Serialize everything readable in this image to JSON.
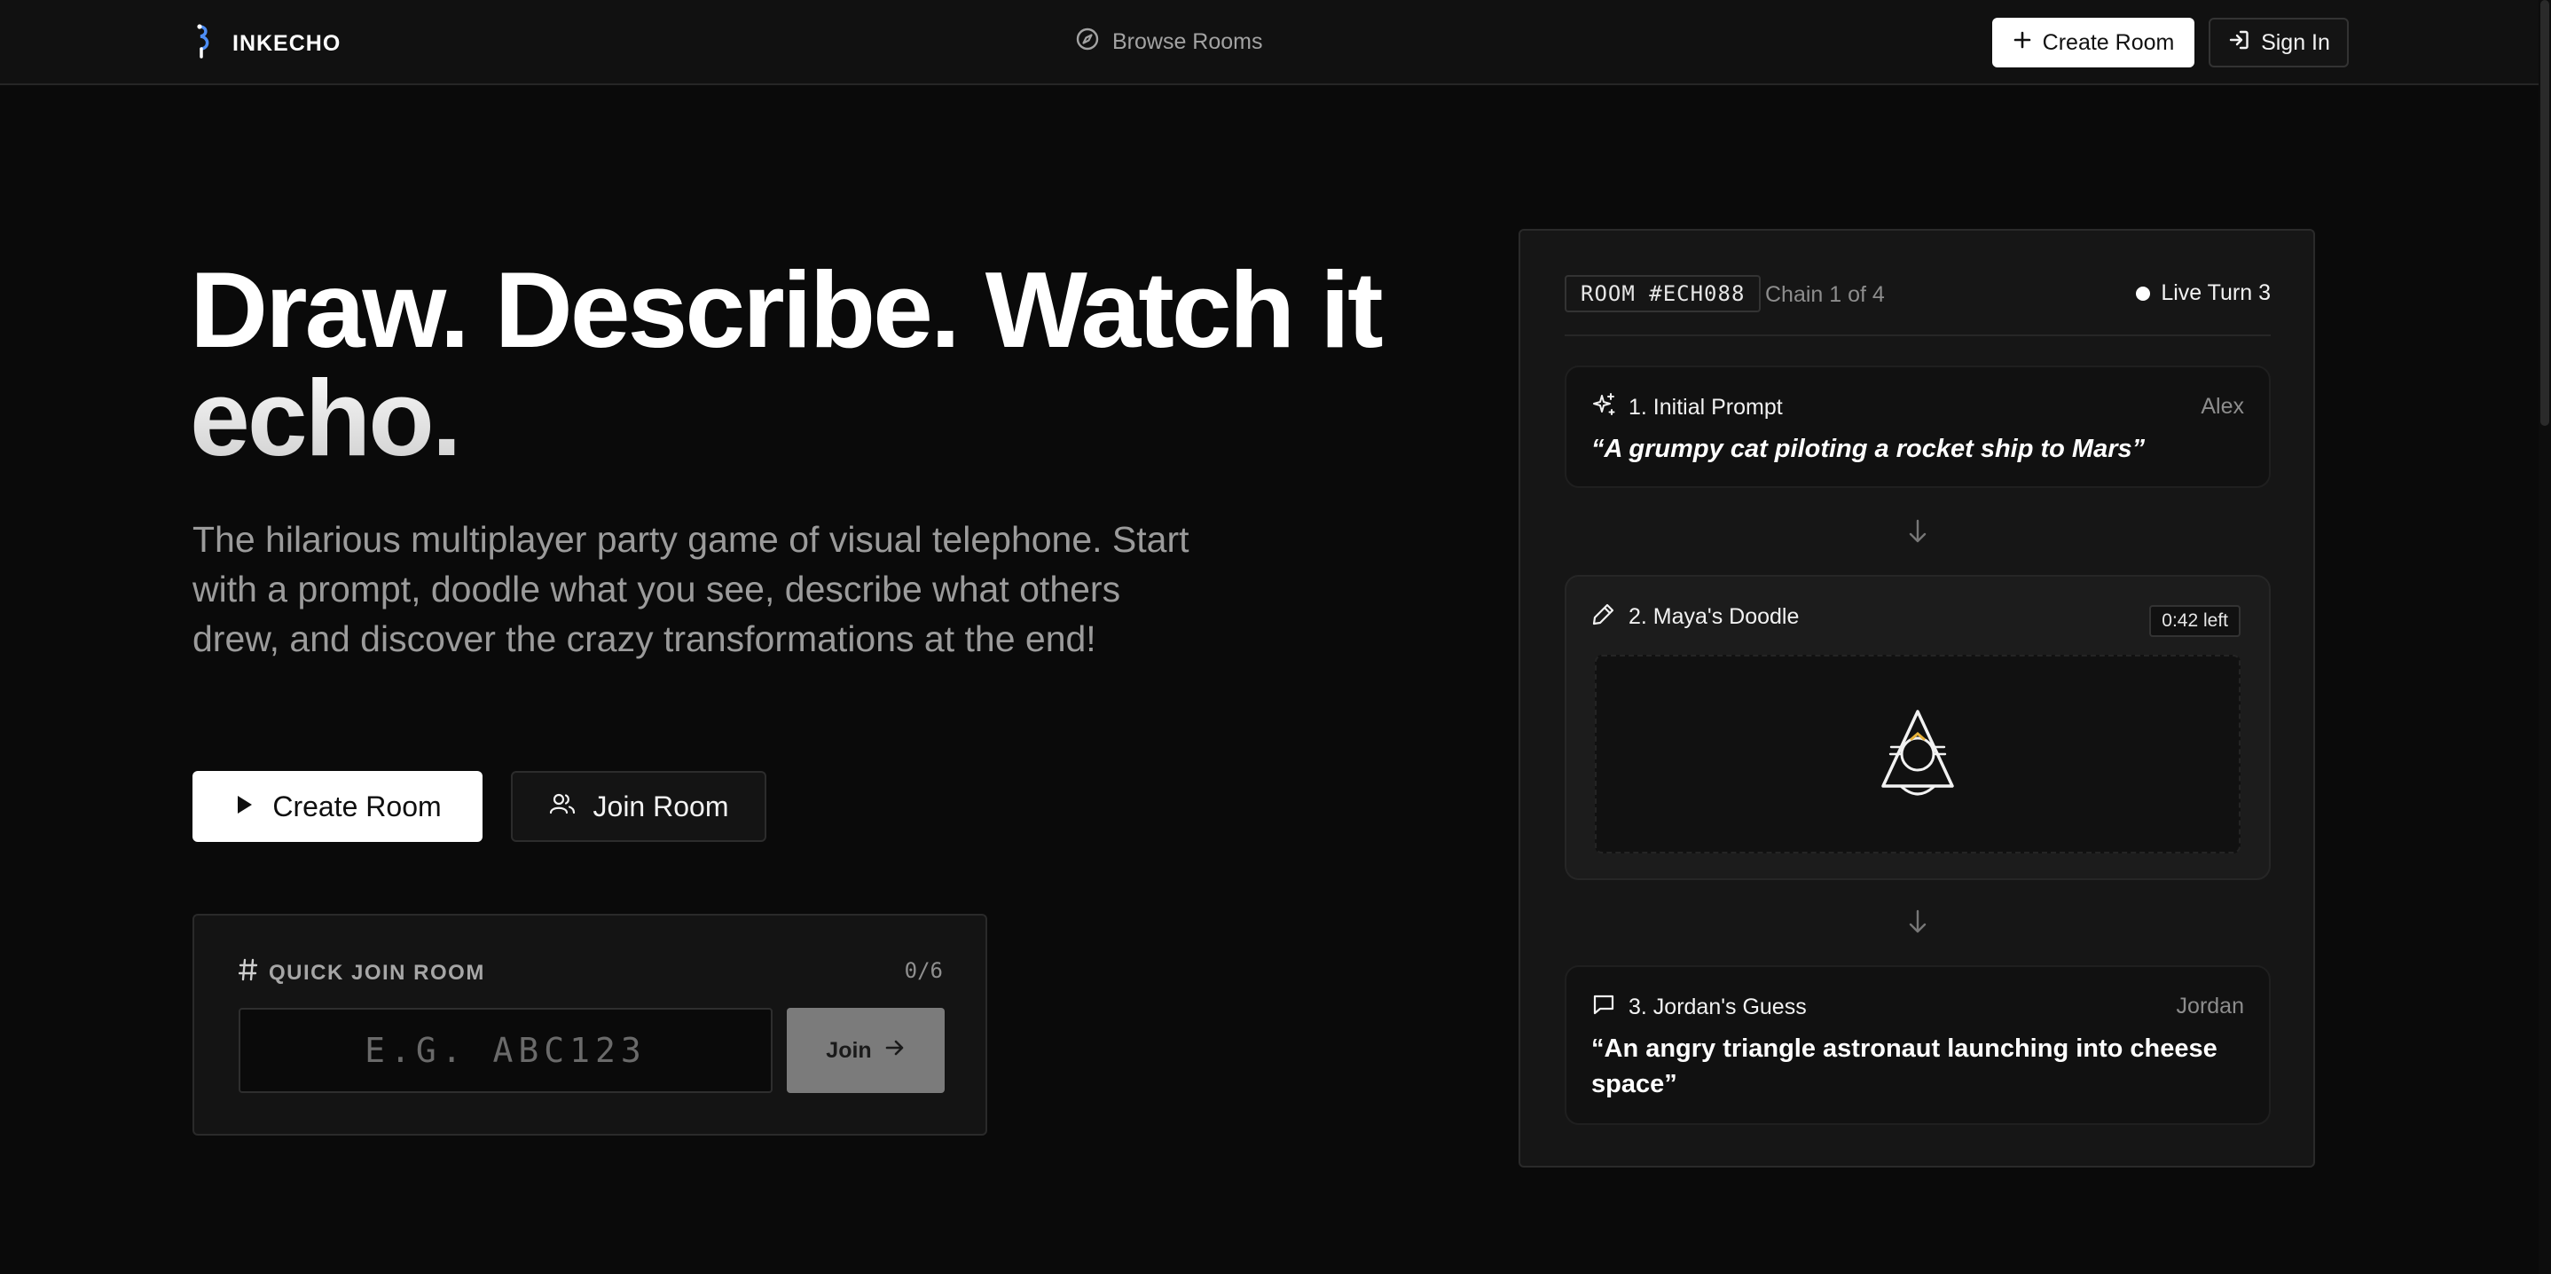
{
  "nav": {
    "brand": "INKECHO",
    "browse_label": "Browse Rooms",
    "create_label": "Create Room",
    "signin_label": "Sign In"
  },
  "hero": {
    "title": "Draw. Describe. Watch it echo.",
    "subtitle": "The hilarious multiplayer party game of visual telephone. Start with a prompt, doodle what you see, describe what others drew, and discover the crazy transformations at the end!",
    "create_label": "Create Room",
    "join_label": "Join Room"
  },
  "quick_join": {
    "label": "QUICK JOIN ROOM",
    "count": "0/6",
    "placeholder": "E.G. ABC123",
    "button_label": "Join"
  },
  "demo": {
    "room_id": "ROOM #ECH088",
    "chain": "Chain 1 of 4",
    "live": "Live Turn 3",
    "steps": [
      {
        "title": "1. Initial Prompt",
        "user": "Alex",
        "quote": "“A grumpy cat piloting a rocket ship to Mars”"
      },
      {
        "title": "2. Maya's Doodle",
        "timer": "0:42 left"
      },
      {
        "title": "3. Jordan's Guess",
        "user": "Jordan",
        "quote": "“An angry triangle astronaut launching into cheese space”"
      }
    ]
  },
  "colors": {
    "background": "#0a0a0a",
    "surface": "#141414",
    "accent_blue": "#4d8df5",
    "doodle_yellow": "#e8b33a"
  }
}
